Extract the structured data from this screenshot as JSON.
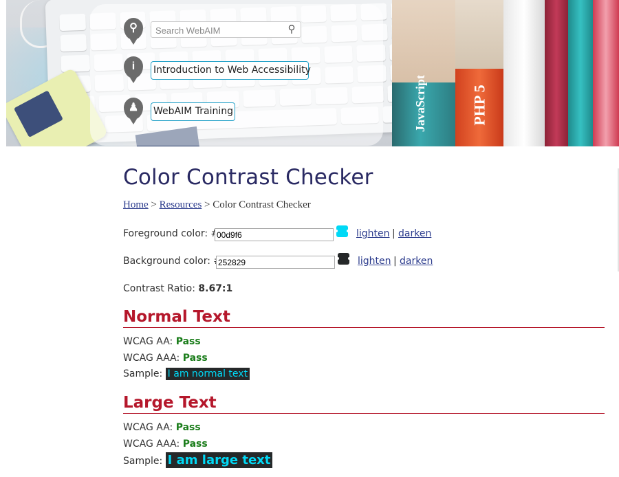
{
  "header": {
    "search_placeholder": "Search WebAIM",
    "nav_links": [
      {
        "label": "Introduction to Web Accessibility"
      },
      {
        "label": "WebAIM Training"
      }
    ],
    "book_spines": [
      "JavaScript",
      "PHP 5"
    ]
  },
  "page": {
    "title": "Color Contrast Checker",
    "breadcrumb": {
      "home": "Home",
      "separator": ">",
      "resources": "Resources",
      "current": "Color Contrast Checker"
    }
  },
  "foreground": {
    "label": "Foreground color: #",
    "value": "00d9f6",
    "color": "#00d9f6",
    "lighten": "lighten",
    "darken": "darken",
    "divider": "|"
  },
  "background": {
    "label": "Background color: #",
    "value": "252829",
    "color": "#252829",
    "lighten": "lighten",
    "darken": "darken",
    "divider": "|"
  },
  "contrast": {
    "label": "Contrast Ratio:",
    "value": "8.67:1"
  },
  "normal_text": {
    "heading": "Normal Text",
    "aa_label": "WCAG AA:",
    "aa_result": "Pass",
    "aaa_label": "WCAG AAA:",
    "aaa_result": "Pass",
    "sample_label": "Sample:",
    "sample_text": "I am normal text"
  },
  "large_text": {
    "heading": "Large Text",
    "aa_label": "WCAG AA:",
    "aa_result": "Pass",
    "aaa_label": "WCAG AAA:",
    "aaa_result": "Pass",
    "sample_label": "Sample:",
    "sample_text": "I am large text"
  },
  "colors": {
    "heading_red": "#b5172b",
    "title_navy": "#2a2a63",
    "pass_green": "#1b7d1b",
    "link_blue": "#2a3a8c",
    "nav_border": "#23a1c8"
  }
}
